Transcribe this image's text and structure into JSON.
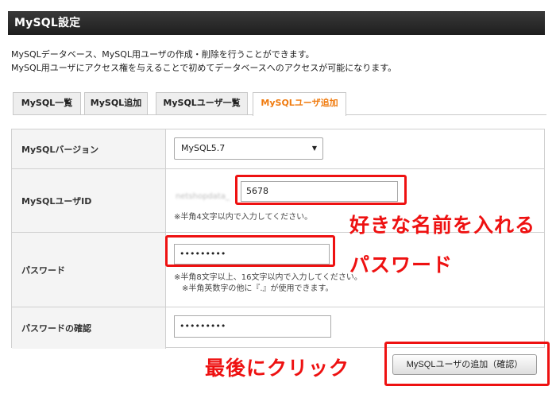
{
  "page": {
    "title": "MySQL設定",
    "description": [
      "MySQLデータベース、MySQL用ユーザの作成・削除を行うことができます。",
      "MySQL用ユーザにアクセス権を与えることで初めてデータベースへのアクセスが可能になります。"
    ]
  },
  "tabs": [
    {
      "label": "MySQL一覧"
    },
    {
      "label": "MySQL追加"
    },
    {
      "label": "MySQLユーザ一覧"
    },
    {
      "label": "MySQLユーザ追加",
      "active": true
    }
  ],
  "form": {
    "version": {
      "label": "MySQLバージョン",
      "selected": "MySQL5.7"
    },
    "user_id": {
      "label": "MySQLユーザID",
      "prefix": "netshopdata_",
      "value": "5678",
      "note": "※半角4文字以内で入力してください。"
    },
    "password": {
      "label": "パスワード",
      "value": "•••••••••",
      "note_1": "※半角8文字以上、16文字以内で入力してください。",
      "note_2": "※半角英数字の他に『.』が使用できます。"
    },
    "password_confirm": {
      "label": "パスワードの確認",
      "value": "•••••••••"
    },
    "submit_label": "MySQLユーザの追加（確認）"
  },
  "annotations": {
    "name_hint": "好きな名前を入れる",
    "password_hint": "パスワード",
    "click_hint": "最後にクリック",
    "color": "#ee1111"
  }
}
